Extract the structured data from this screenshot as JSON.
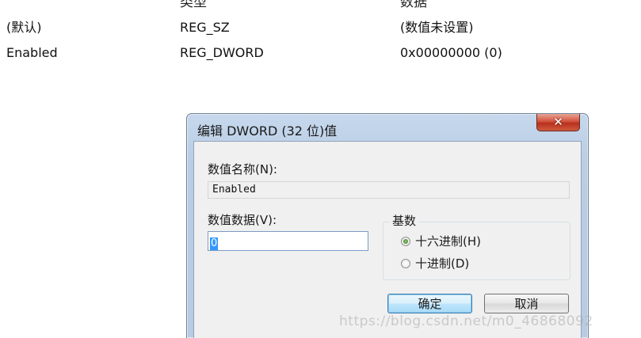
{
  "registry": {
    "header_fragments": [
      "",
      "类型",
      "数据"
    ],
    "rows": [
      {
        "name": "(默认)",
        "type": "REG_SZ",
        "data": "(数值未设置)"
      },
      {
        "name": "Enabled",
        "type": "REG_DWORD",
        "data": "0x00000000 (0)"
      }
    ]
  },
  "dialog": {
    "title": "编辑 DWORD (32 位)值",
    "close_icon": "close-icon",
    "value_name_label": "数值名称(N):",
    "value_name": "Enabled",
    "value_data_label": "数值数据(V):",
    "value_data": "0",
    "base_label": "基数",
    "radios": [
      {
        "label": "十六进制(H)",
        "checked": true
      },
      {
        "label": "十进制(D)",
        "checked": false
      }
    ],
    "ok_label": "确定",
    "cancel_label": "取消"
  },
  "watermark": "https://blog.csdn.net/m0_46868092",
  "colors": {
    "frame": "#b9cde5",
    "close_button": "#c8412b",
    "selection": "#3399ff",
    "client_bg": "#f0f0f0"
  }
}
